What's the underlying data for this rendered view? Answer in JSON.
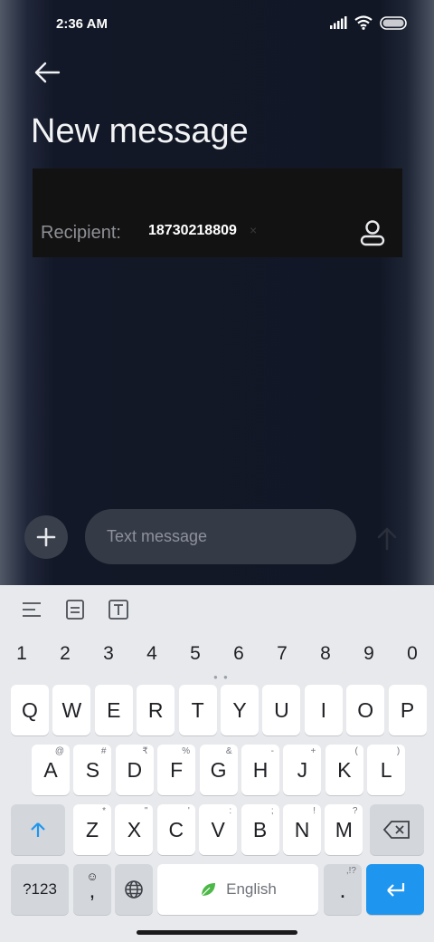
{
  "status_bar": {
    "time": "2:36 AM"
  },
  "header": {
    "title": "New message"
  },
  "recipient": {
    "label": "Recipient:",
    "value": "18730218809",
    "remove": "×"
  },
  "compose": {
    "placeholder": "Text message"
  },
  "keyboard": {
    "numbers": [
      "1",
      "2",
      "3",
      "4",
      "5",
      "6",
      "7",
      "8",
      "9",
      "0"
    ],
    "row1": [
      {
        "k": "Q",
        "h": ""
      },
      {
        "k": "W",
        "h": ""
      },
      {
        "k": "E",
        "h": ""
      },
      {
        "k": "R",
        "h": ""
      },
      {
        "k": "T",
        "h": ""
      },
      {
        "k": "Y",
        "h": ""
      },
      {
        "k": "U",
        "h": ""
      },
      {
        "k": "I",
        "h": ""
      },
      {
        "k": "O",
        "h": ""
      },
      {
        "k": "P",
        "h": ""
      }
    ],
    "row2": [
      {
        "k": "A",
        "h": "@"
      },
      {
        "k": "S",
        "h": "#"
      },
      {
        "k": "D",
        "h": "₹"
      },
      {
        "k": "F",
        "h": "%"
      },
      {
        "k": "G",
        "h": "&"
      },
      {
        "k": "H",
        "h": "-"
      },
      {
        "k": "J",
        "h": "+"
      },
      {
        "k": "K",
        "h": "("
      },
      {
        "k": "L",
        "h": ")"
      }
    ],
    "row3": [
      {
        "k": "Z",
        "h": "*"
      },
      {
        "k": "X",
        "h": "\""
      },
      {
        "k": "C",
        "h": "'"
      },
      {
        "k": "V",
        "h": ":"
      },
      {
        "k": "B",
        "h": ";"
      },
      {
        "k": "N",
        "h": "!"
      },
      {
        "k": "M",
        "h": "?"
      }
    ],
    "symbols_label": "?123",
    "comma_label": ",",
    "space_label": "English",
    "period_label": ".",
    "period_hint": ",!?"
  },
  "colors": {
    "accent": "#1e96f0",
    "background": "#111725",
    "keyboard": "#e7e9ec"
  }
}
